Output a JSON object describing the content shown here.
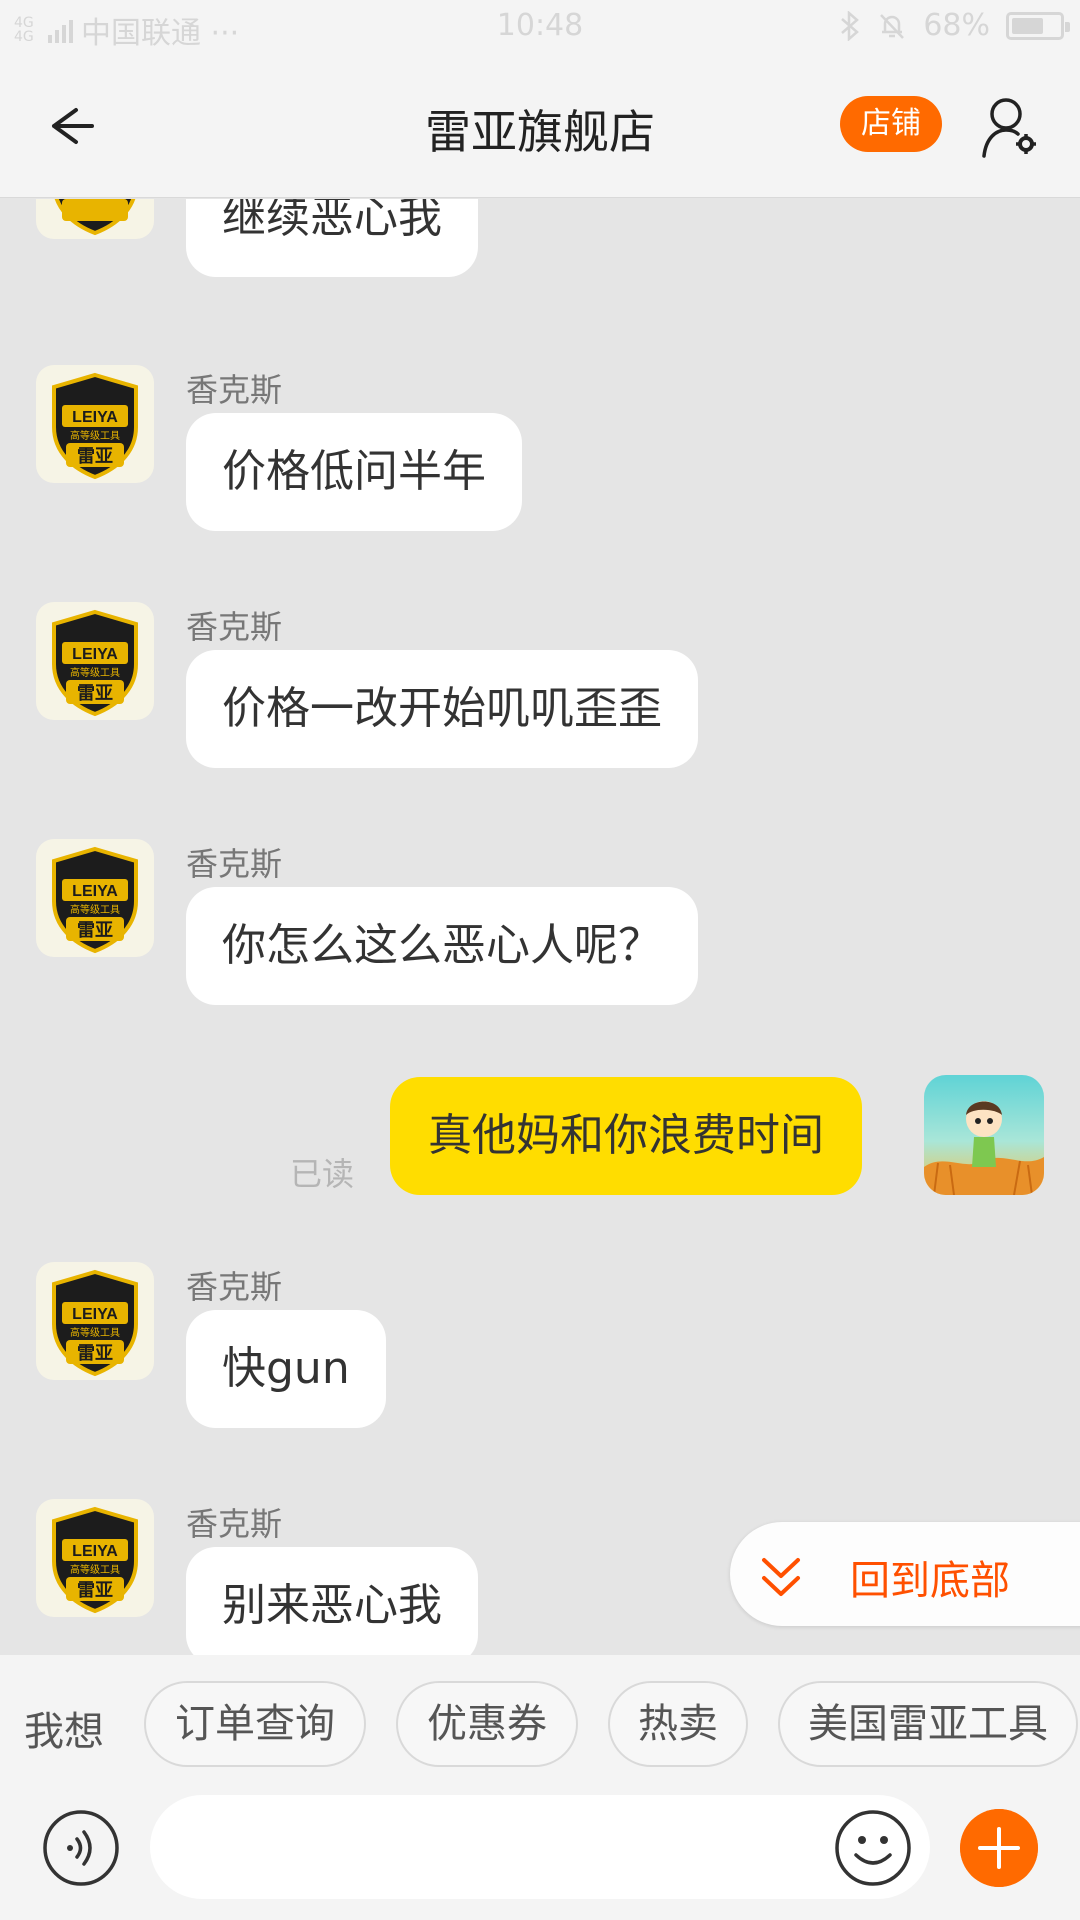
{
  "status_bar": {
    "network": "4G 4G",
    "carrier": "中国联通 ···",
    "time": "10:48",
    "battery": "68%",
    "battery_level": 0.68
  },
  "header": {
    "title": "雷亚旗舰店",
    "shop_button": "店铺"
  },
  "shop_avatar": {
    "brand": "LEIYA",
    "subtitle": "高等级工具",
    "name": "雷亚"
  },
  "messages": [
    {
      "sender": "",
      "text": "继续恶心我"
    },
    {
      "sender": "香克斯",
      "text": "价格低问半年"
    },
    {
      "sender": "香克斯",
      "text": "价格一改开始叽叽歪歪"
    },
    {
      "sender": "香克斯",
      "text": "你怎么这么恶心人呢？"
    },
    {
      "sender": "me",
      "text": "真他妈和你浪费时间",
      "status": "已读"
    },
    {
      "sender": "香克斯",
      "text": "快gun"
    },
    {
      "sender": "香克斯",
      "text": "别来恶心我"
    }
  ],
  "back_to_bottom": "回到底部",
  "quick_replies": {
    "label": "我想",
    "chips": [
      "订单查询",
      "优惠券",
      "热卖",
      "美国雷亚工具"
    ]
  },
  "input": {
    "value": "",
    "placeholder": ""
  },
  "colors": {
    "accent": "#ff6a00",
    "my_bubble": "#ffdd00",
    "chat_bg": "#e5e5e5"
  }
}
